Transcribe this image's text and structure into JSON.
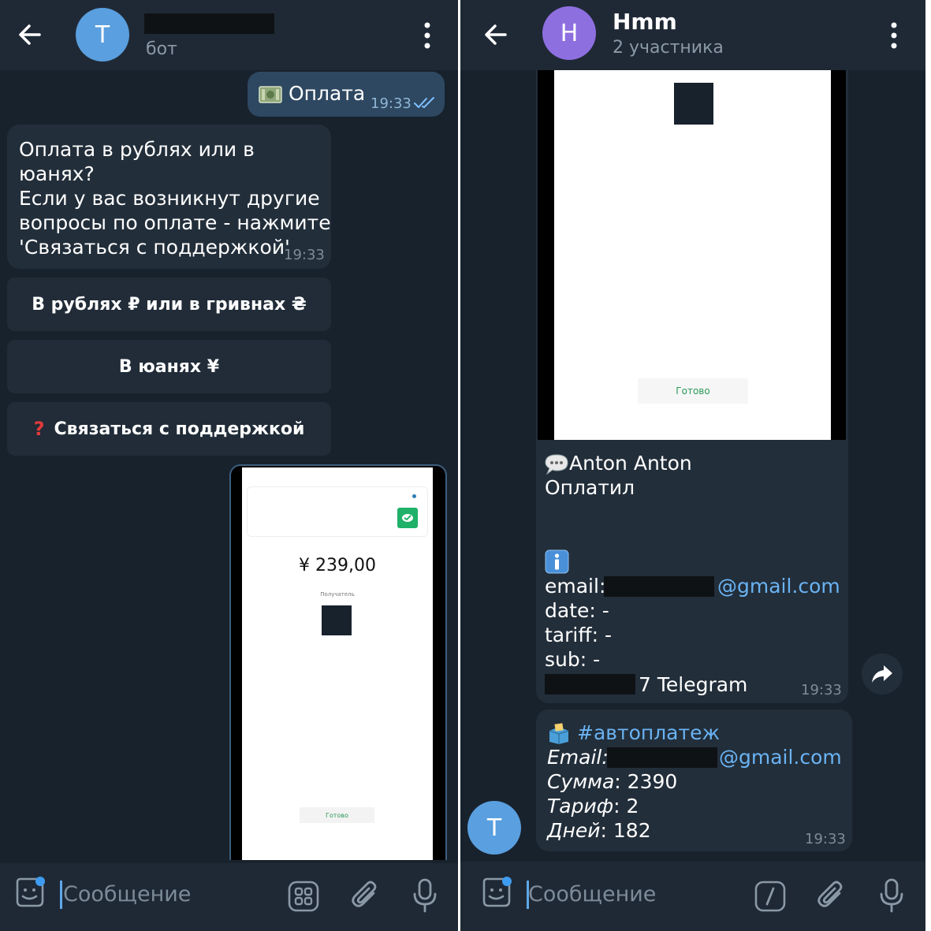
{
  "left": {
    "header": {
      "avatar_letter": "T",
      "subtitle": "бот"
    },
    "outgoing": {
      "text": "Оплата",
      "time": "19:33"
    },
    "incoming": {
      "line1": "Оплата в рублях или в юанях?",
      "line2": "Если у вас возникнут другие",
      "line3": "вопросы по оплате - нажмите",
      "line4": "'Связаться с поддержкой'",
      "time": "19:33"
    },
    "buttons": {
      "rub": "В рублях ₽ или в гривнах ₴",
      "yuan": "В юанях ¥",
      "support": "Связаться с поддержкой"
    },
    "receipt": {
      "amount": "¥ 239,00",
      "recipient_label": "Получатель",
      "done": "Готово"
    },
    "composer": {
      "placeholder": "Сообщение"
    }
  },
  "right": {
    "header": {
      "avatar_letter": "H",
      "title": "Hmm",
      "subtitle": "2 участника"
    },
    "receipt": {
      "done": "Готово"
    },
    "message1": {
      "name": "Anton Anton",
      "status": "Оплатил",
      "email_label": "email:",
      "email_domain": "@gmail.com",
      "date": "date: -",
      "tariff": "tariff: -",
      "sub": "sub: -",
      "telegram": "7 Telegram",
      "time": "19:33"
    },
    "message2": {
      "hashtag": "#автоплатеж",
      "email_label": "Email",
      "email_domain": "@gmail.com",
      "sum_label": "Сумма",
      "sum_value": "2390",
      "tariff_label": "Тариф",
      "tariff_value": "2",
      "days_label": "Дней",
      "days_value": "182",
      "time": "19:33"
    },
    "sender_avatar_letter": "T",
    "composer": {
      "placeholder": "Сообщение"
    }
  },
  "colors": {
    "accent": "#5ea8e8",
    "link": "#6ab3f3",
    "avatar_blue": "#5a9fdf",
    "avatar_purple": "#8e6fe0",
    "background": "#18222d"
  },
  "icons": [
    "back-arrow-icon",
    "more-vertical-icon",
    "check-double-icon",
    "sticker-icon",
    "keyboard-grid-icon",
    "bot-command-icon",
    "paperclip-icon",
    "microphone-icon",
    "forward-icon",
    "info-icon",
    "speech-bubble-icon",
    "ballot-box-icon",
    "money-icon",
    "question-mark-icon"
  ]
}
